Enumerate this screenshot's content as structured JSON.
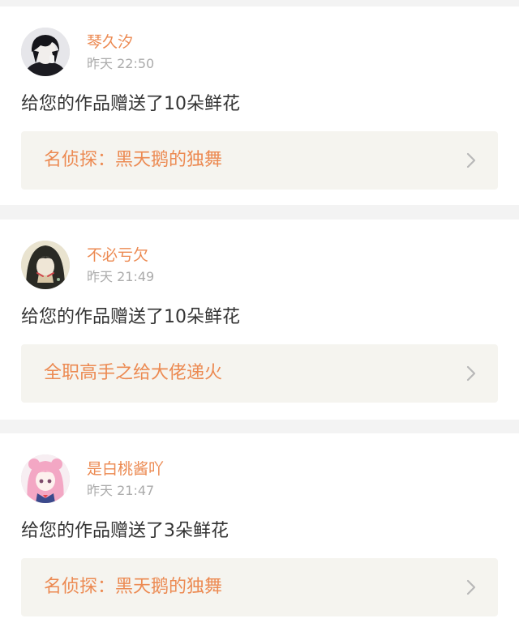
{
  "notifications": [
    {
      "username": "琴久汐",
      "time": "昨天 22:50",
      "message": "给您的作品赠送了10朵鲜花",
      "work_title": "名侦探：黑天鹅的独舞",
      "avatar_icon": "avatar-dark-hair-boy-icon"
    },
    {
      "username": "不必亏欠",
      "time": "昨天 21:49",
      "message": "给您的作品赠送了10朵鲜花",
      "work_title": "全职高手之给大佬递火",
      "avatar_icon": "avatar-dark-hair-girl-icon"
    },
    {
      "username": "是白桃酱吖",
      "time": "昨天 21:47",
      "message": "给您的作品赠送了3朵鲜花",
      "work_title": "名侦探：黑天鹅的独舞",
      "avatar_icon": "avatar-pink-hair-girl-icon"
    }
  ],
  "colors": {
    "accent": "#ec8a52",
    "timestamp": "#ababab",
    "text": "#333333",
    "link_background": "#f5f4ef",
    "page_background": "#f3f3f3"
  }
}
